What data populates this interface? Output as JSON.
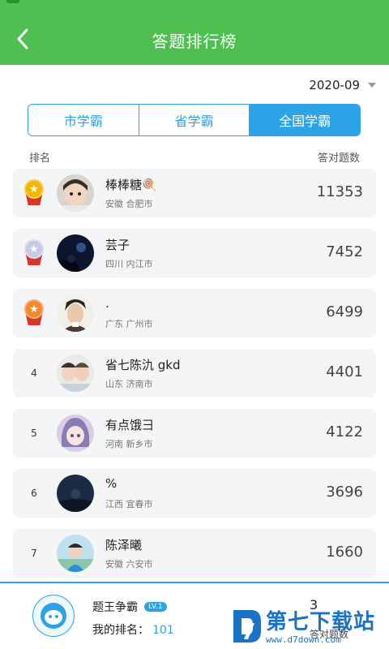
{
  "header": {
    "title": "答题排行榜"
  },
  "date_filter": {
    "selected": "2020-09"
  },
  "tabs": [
    {
      "label": "市学霸",
      "active": false
    },
    {
      "label": "省学霸",
      "active": false
    },
    {
      "label": "全国学霸",
      "active": true
    }
  ],
  "list_header": {
    "rank_label": "排名",
    "count_label": "答对题数"
  },
  "rows": [
    {
      "rank": "1",
      "medal": "gold",
      "name": "棒棒糖🍭",
      "location": "安徽 合肥市",
      "score": "11353"
    },
    {
      "rank": "2",
      "medal": "silver",
      "name": "芸子",
      "location": "四川 内江市",
      "score": "7452"
    },
    {
      "rank": "3",
      "medal": "bronze",
      "name": ".",
      "location": "广东 广州市",
      "score": "6499"
    },
    {
      "rank": "4",
      "medal": "",
      "name": "省七陈氿 gkd",
      "location": "山东 济南市",
      "score": "4401"
    },
    {
      "rank": "5",
      "medal": "",
      "name": "有点饿⺕",
      "location": "河南 新乡市",
      "score": "4122"
    },
    {
      "rank": "6",
      "medal": "",
      "name": "%",
      "location": "江西 宜春市",
      "score": "3696"
    },
    {
      "rank": "7",
      "medal": "",
      "name": "陈泽曦",
      "location": "安徽 六安市",
      "score": "1660"
    }
  ],
  "footer": {
    "game_name": "题王争霸",
    "level": "LV.1",
    "my_rank_label": "我的排名：",
    "my_rank": "101",
    "count": "3",
    "count_label": "答对题数"
  },
  "watermark": {
    "brand": "第七下载站",
    "url": "www.d7down.com"
  },
  "colors": {
    "accent": "#2ba3e6",
    "header_green": "#4fbf52",
    "gold": "#f5b800",
    "silver": "#c9c9e6",
    "bronze": "#f08a2a"
  }
}
